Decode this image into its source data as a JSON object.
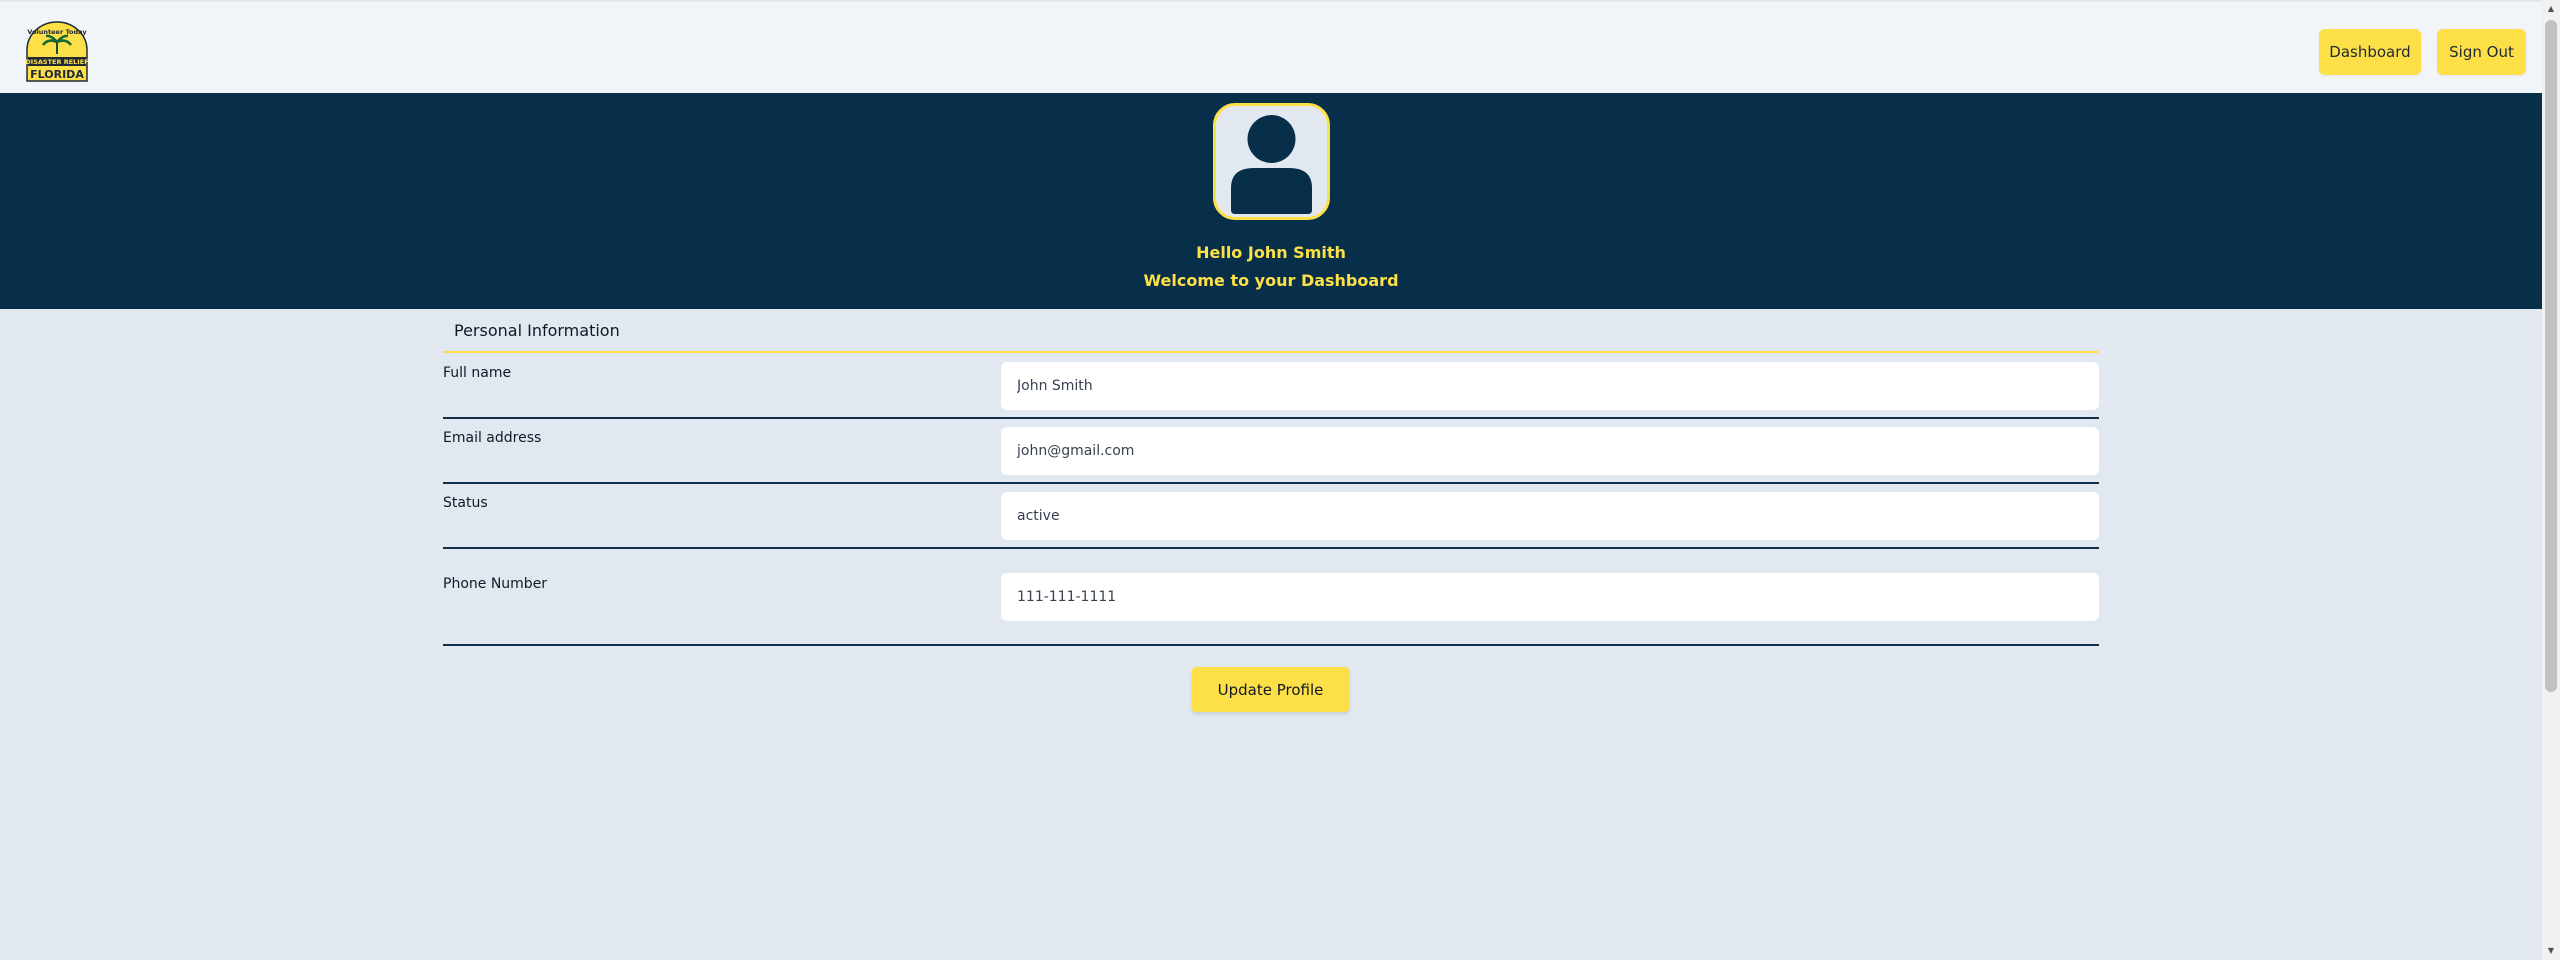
{
  "header": {
    "logo_icon": "volunteer-disaster-relief-florida-logo",
    "logo_text_top": "Volunteer Today",
    "logo_text_mid": "DISASTER RELIEF",
    "logo_text_bottom": "FLORIDA",
    "dashboard_label": "Dashboard",
    "signout_label": "Sign Out"
  },
  "hero": {
    "avatar_icon": "user-avatar-icon",
    "greeting": "Hello John Smith",
    "welcome": "Welcome to your Dashboard"
  },
  "profile": {
    "section_title": "Personal Information",
    "fields": [
      {
        "label": "Full name",
        "value": "John Smith"
      },
      {
        "label": "Email address",
        "value": "john@gmail.com"
      },
      {
        "label": "Status",
        "value": "active"
      },
      {
        "label": "Phone Number",
        "value": "111-111-1111"
      }
    ],
    "update_label": "Update Profile"
  },
  "colors": {
    "accent": "#fde047",
    "navy": "#082f4a",
    "page_bg": "#e2e8f0",
    "topbar_bg": "#f1f5f9"
  }
}
